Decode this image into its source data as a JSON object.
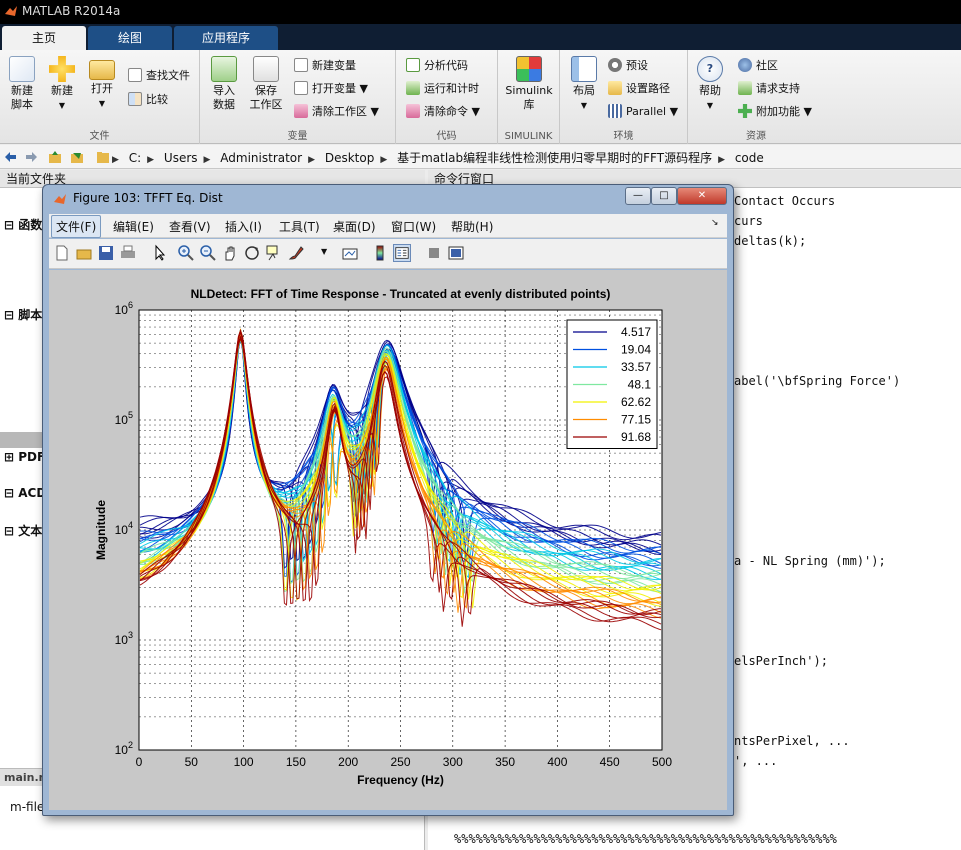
{
  "app": {
    "title": "MATLAB R2014a"
  },
  "ribbon": {
    "tabs": [
      {
        "label": "主页"
      },
      {
        "label": "绘图"
      },
      {
        "label": "应用程序"
      }
    ],
    "file_group": {
      "title": "文件",
      "new_script": "新建\n脚本",
      "new": "新建",
      "open": "打开",
      "find_files": "查找文件",
      "compare": "比较"
    },
    "variable_group": {
      "title": "变量",
      "import": "导入\n数据",
      "save_ws": "保存\n工作区",
      "new_var": "新建变量",
      "open_var": "打开变量",
      "clear_ws": "清除工作区"
    },
    "code_group": {
      "title": "代码",
      "analyze": "分析代码",
      "run_time": "运行和计时",
      "clear_cmd": "清除命令"
    },
    "simulink_group": {
      "title": "SIMULINK",
      "library": "Simulink\n库"
    },
    "env_group": {
      "title": "环境",
      "layout": "布局",
      "prefs": "预设",
      "set_path": "设置路径",
      "parallel": "Parallel"
    },
    "resources_group": {
      "title": "资源",
      "help": "帮助",
      "community": "社区",
      "support": "请求支持",
      "addons": "附加功能"
    }
  },
  "address": {
    "crumbs": [
      "C:",
      "Users",
      "Administrator",
      "Desktop",
      "基于matlab编程非线性检测使用归零早期时的FFT源码程序",
      "code"
    ]
  },
  "left_panel": {
    "title": "当前文件夹",
    "sections": [
      "函数",
      "脚本",
      "PDF",
      "ACD",
      "文本"
    ],
    "bottom_tab": "main.m",
    "detail": "m-file"
  },
  "command_window": {
    "title": "命令行窗口",
    "lines": [
      "Contact Occurs",
      "curs",
      "deltas(k);",
      "abel('\\bfSpring Force')",
      "a - NL Spring (mm)');",
      "elsPerInch');",
      "ntsPerPixel, ...",
      "', ...",
      "%%%%%%%%%%%%%%%%%%%%%%%%%%%%%%%%%%%%%%%%%%%%%%%%%%%%%"
    ]
  },
  "figure": {
    "title": "Figure 103: TFFT Eq. Dist",
    "menus": [
      "文件(F)",
      "编辑(E)",
      "查看(V)",
      "插入(I)",
      "工具(T)",
      "桌面(D)",
      "窗口(W)",
      "帮助(H)"
    ]
  },
  "chart_data": {
    "type": "line",
    "title": "NLDetect:  FFT of Time Response - Truncated at evenly distributed points)",
    "xlabel": "Frequency (Hz)",
    "ylabel": "Magnitude",
    "xlim": [
      0,
      500
    ],
    "ylim": [
      100,
      1000000
    ],
    "yscale": "log",
    "x_ticks": [
      0,
      50,
      100,
      150,
      200,
      250,
      300,
      350,
      400,
      450,
      500
    ],
    "y_ticks": [
      "10^2",
      "10^3",
      "10^4",
      "10^5",
      "10^6"
    ],
    "grid": true,
    "legend_position": "top-right",
    "series": [
      {
        "name": "4.517",
        "color": "#00008b"
      },
      {
        "name": "19.04",
        "color": "#0050e0"
      },
      {
        "name": "33.57",
        "color": "#00c8e6"
      },
      {
        "name": "48.1",
        "color": "#7fe8a0"
      },
      {
        "name": "62.62",
        "color": "#f2f200"
      },
      {
        "name": "77.15",
        "color": "#ff8c00"
      },
      {
        "name": "91.68",
        "color": "#9b0000"
      }
    ]
  }
}
